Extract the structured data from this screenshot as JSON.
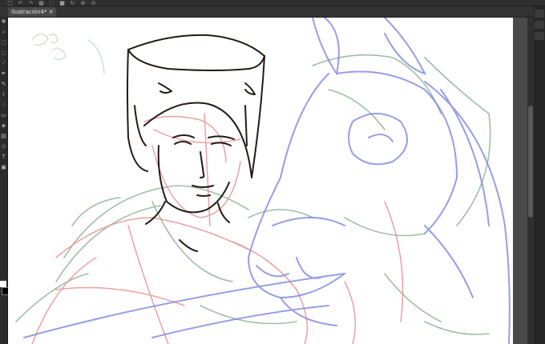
{
  "window": {
    "document_tab": "Ilustración4*"
  },
  "toolbar": {
    "icons": [
      "new-icon",
      "undo-icon",
      "redo-icon",
      "select-all-icon",
      "transform-icon",
      "color-icon",
      "rotate-icon",
      "zoom-in-icon",
      "zoom-out-icon"
    ]
  },
  "toolbox": {
    "tools": [
      "move-tool-icon",
      "zoom-tool-icon",
      "selection-tool-icon",
      "lasso-tool-icon",
      "eyedropper-tool-icon",
      "pen-tool-icon",
      "pencil-tool-icon",
      "brush-tool-icon",
      "airbrush-tool-icon",
      "eraser-tool-icon",
      "fill-tool-icon",
      "gradient-tool-icon",
      "shape-tool-icon",
      "text-tool-icon",
      "frame-tool-icon"
    ],
    "main_color": "#ffffff",
    "sub_color": "#000000"
  },
  "canvas": {
    "background": "#ffffff",
    "stroke_colors": {
      "ink": "#231a16",
      "red": "#e88a8a",
      "green": "#8fb495",
      "blue": "#7d86e0"
    }
  }
}
